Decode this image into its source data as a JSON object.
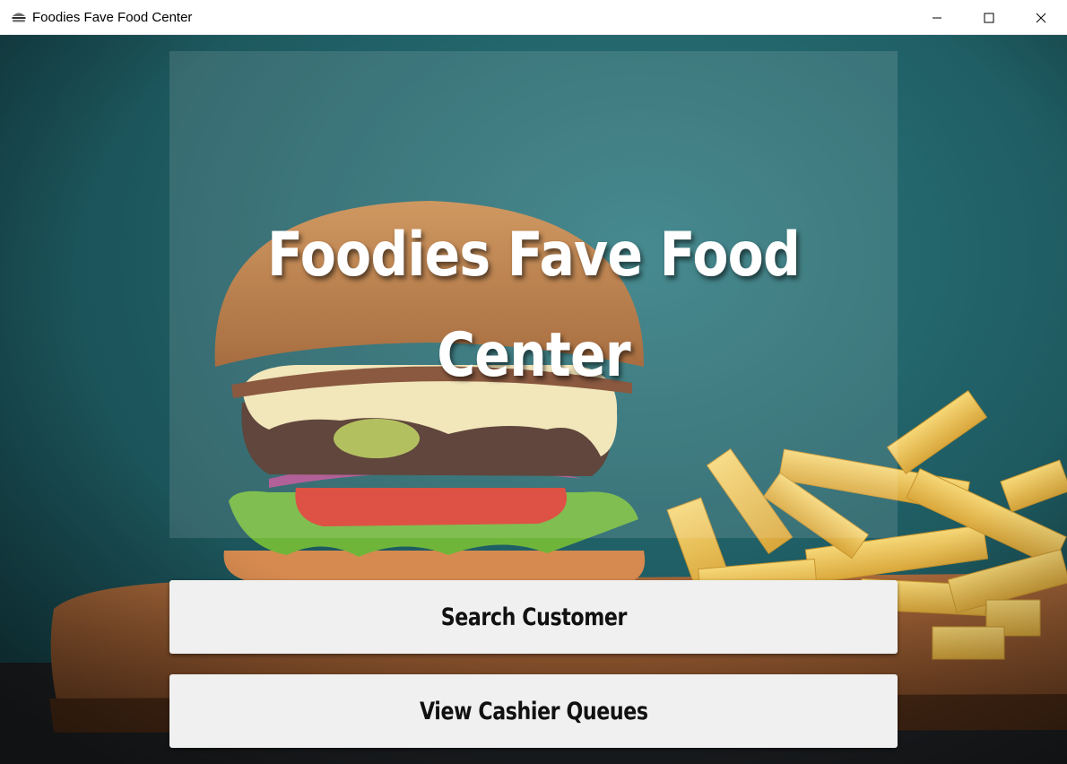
{
  "window": {
    "title": "Foodies Fave Food Center",
    "icon": "burger-app-icon",
    "controls": [
      "minimize-icon",
      "maximize-icon",
      "close-icon"
    ]
  },
  "hero": {
    "title_line1": "Foodies Fave Food",
    "title_line2": "Center"
  },
  "actions": {
    "search_label": "Search Customer",
    "queues_label": "View Cashier Queues"
  },
  "colors": {
    "background_teal": "#1f5e64",
    "button_bg": "#f0f0f0",
    "title_text": "#ffffff"
  }
}
